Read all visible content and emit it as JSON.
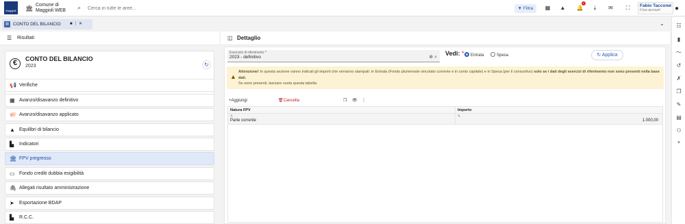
{
  "topbar": {
    "logo_text": "Maggioli",
    "comune_line1": "Comune di",
    "comune_line2": "Maggioli WEB",
    "search_placeholder": "Cerca in tutte le aree...",
    "filtra_label": "Filtra",
    "notif_count": "1",
    "user_name": "Fabio Tacconelli",
    "user_role": "Il tuo account"
  },
  "tabs": [
    {
      "label": "CONTO DEL BILANCIO",
      "icon": "document-icon"
    }
  ],
  "left": {
    "header": "Risultati",
    "card_title": "CONTO DEL BILANCIO",
    "card_year": "2023",
    "items": [
      {
        "label": "Verifiche",
        "icon": "megaphone-icon"
      },
      {
        "label": "Avanzo/disavanzo definitivo",
        "icon": "calculator-icon"
      },
      {
        "label": "Avanzo/disavanzo applicato",
        "icon": "piggy-bank-icon"
      },
      {
        "label": "Equilibri di bilancio",
        "icon": "shapes-icon"
      },
      {
        "label": "Indicatori",
        "icon": "document-icon"
      },
      {
        "label": "FPV pregresso",
        "icon": "bank-icon",
        "active": true
      },
      {
        "label": "Fondo crediti dubbia esigibilità",
        "icon": "credit-card-icon"
      },
      {
        "label": "Allegati risultato amministrazione",
        "icon": "paperclip-icon"
      },
      {
        "label": "Esportazione BDAP",
        "icon": "send-icon"
      },
      {
        "label": "R.C.C.",
        "icon": "document-icon"
      }
    ]
  },
  "main": {
    "header": "Dettaglio",
    "esercizio_label": "Esercizio di riferimento",
    "esercizio_required": "*",
    "esercizio_value": "2023 - definitivo",
    "vedi_label": "Vedi:",
    "vedi_required": "*",
    "radio_entrata": "Entrata",
    "radio_spesa": "Spesa",
    "applica_label": "Applica",
    "warning_bold": "Attenzione!",
    "warning_text1": " In questa sezione vanno indicati gli importi che verranno stampati: in Entrata (Fondo pluriennale vincolato corrente e in conto capitale) e in Spesa (per il consuntivo) ",
    "warning_bold2": "solo se i dati degli esercizi di riferimento non sono presenti nella base dati.",
    "warning_text2": "Se sono presenti, lasciare vuota questa tabella.",
    "toolbar_add": "Aggiungi nuova riga",
    "toolbar_delete": "Cancella righe selezionate",
    "col_natura": "Natura FPV",
    "col_importo": "Importo",
    "rows": [
      {
        "natura": "Parte corrente",
        "importo": "1.000,00"
      }
    ]
  },
  "colors": {
    "accent": "#2a5ab0",
    "warning_bg": "#fdf2d4",
    "active_item": "#dfe9f8"
  }
}
